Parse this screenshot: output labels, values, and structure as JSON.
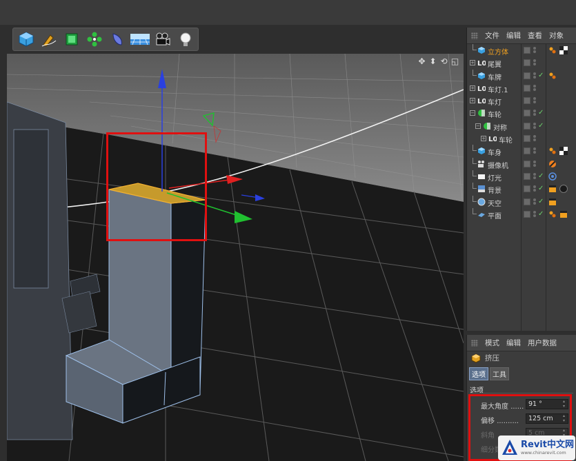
{
  "toolbar": {
    "tools": [
      {
        "name": "cube-tool",
        "icon": "cube-icon"
      },
      {
        "name": "pen-tool",
        "icon": "pen-icon"
      },
      {
        "name": "subdivision-tool",
        "icon": "subdivision-icon"
      },
      {
        "name": "array-tool",
        "icon": "array-icon"
      },
      {
        "name": "deformer-tool",
        "icon": "deformer-icon"
      },
      {
        "name": "floor-tool",
        "icon": "floor-icon"
      },
      {
        "name": "camera-tool",
        "icon": "camera-icon"
      },
      {
        "name": "light-tool",
        "icon": "light-icon"
      }
    ]
  },
  "viewport": {
    "nav_icons": [
      "move-view-icon",
      "dolly-view-icon",
      "rotate-view-icon",
      "maximize-view-icon"
    ],
    "nav_glyphs": [
      "✥",
      "⬍",
      "⟲",
      "◱"
    ]
  },
  "object_manager": {
    "menu": [
      "文件",
      "编辑",
      "查看",
      "对象"
    ],
    "objects": [
      {
        "label": "立方体",
        "icon": "cube-icon",
        "selected": true,
        "check": false,
        "tags": [
          "phong-tag-icon",
          "checker-tag-icon"
        ]
      },
      {
        "label": "尾翼",
        "icon": "null-icon",
        "expander": "+",
        "check": false,
        "tags": []
      },
      {
        "label": "车牌",
        "icon": "cube-icon",
        "check": true,
        "tags": [
          "phong-tag-icon"
        ]
      },
      {
        "label": "车灯.1",
        "icon": "null-icon",
        "expander": "+",
        "check": false,
        "tags": []
      },
      {
        "label": "车灯",
        "icon": "null-icon",
        "expander": "+",
        "check": false,
        "tags": []
      },
      {
        "label": "车轮",
        "icon": "symmetry-icon",
        "expander": "−",
        "check": true,
        "tags": []
      },
      {
        "label": "对称",
        "icon": "symmetry-icon",
        "expander": "−",
        "indent": 1,
        "check": true,
        "tags": []
      },
      {
        "label": "车轮",
        "icon": "null-icon",
        "expander": "+",
        "indent": 2,
        "check": false,
        "tags": []
      },
      {
        "label": "车身",
        "icon": "cube-icon",
        "check": false,
        "tags": [
          "phong-tag-icon",
          "checker-tag-icon"
        ]
      },
      {
        "label": "摄像机",
        "icon": "camera-icon",
        "check": false,
        "tags": [
          "no-entry-tag-icon"
        ]
      },
      {
        "label": "灯光",
        "icon": "light-icon",
        "check": true,
        "tags": [
          "target-tag-icon"
        ]
      },
      {
        "label": "背景",
        "icon": "background-icon",
        "check": true,
        "tags": [
          "clapper-tag-icon",
          "sphere-tag-icon"
        ]
      },
      {
        "label": "天空",
        "icon": "sky-icon",
        "check": true,
        "tags": [
          "clapper-tag-icon"
        ]
      },
      {
        "label": "平面",
        "icon": "plane-icon",
        "check": true,
        "tags": [
          "phong-tag-icon",
          "clapper-tag-icon"
        ]
      }
    ]
  },
  "attributes": {
    "menu": [
      "模式",
      "编辑",
      "用户数据"
    ],
    "object_name": "挤压",
    "tabs": [
      "选项",
      "工具"
    ],
    "section": "选项",
    "params": [
      {
        "label": "最大角度",
        "dots": "......",
        "value": "91 °",
        "disabled": false
      },
      {
        "label": "偏移",
        "dots": "..........",
        "value": "125 cm",
        "disabled": false
      },
      {
        "label": "斜角",
        "dots": "",
        "value": "5 cm",
        "disabled": true
      },
      {
        "label": "细分数",
        "dots": "",
        "value": "",
        "disabled": true
      }
    ]
  },
  "watermark": {
    "main": "Revit中文网",
    "sub": "www.chinarevit.com"
  },
  "colors": {
    "selected_label": "#f0a020",
    "highlight_box": "#e01010",
    "x_axis": "#e02020",
    "y_axis": "#1f3fe0",
    "z_axis": "#20c020"
  }
}
